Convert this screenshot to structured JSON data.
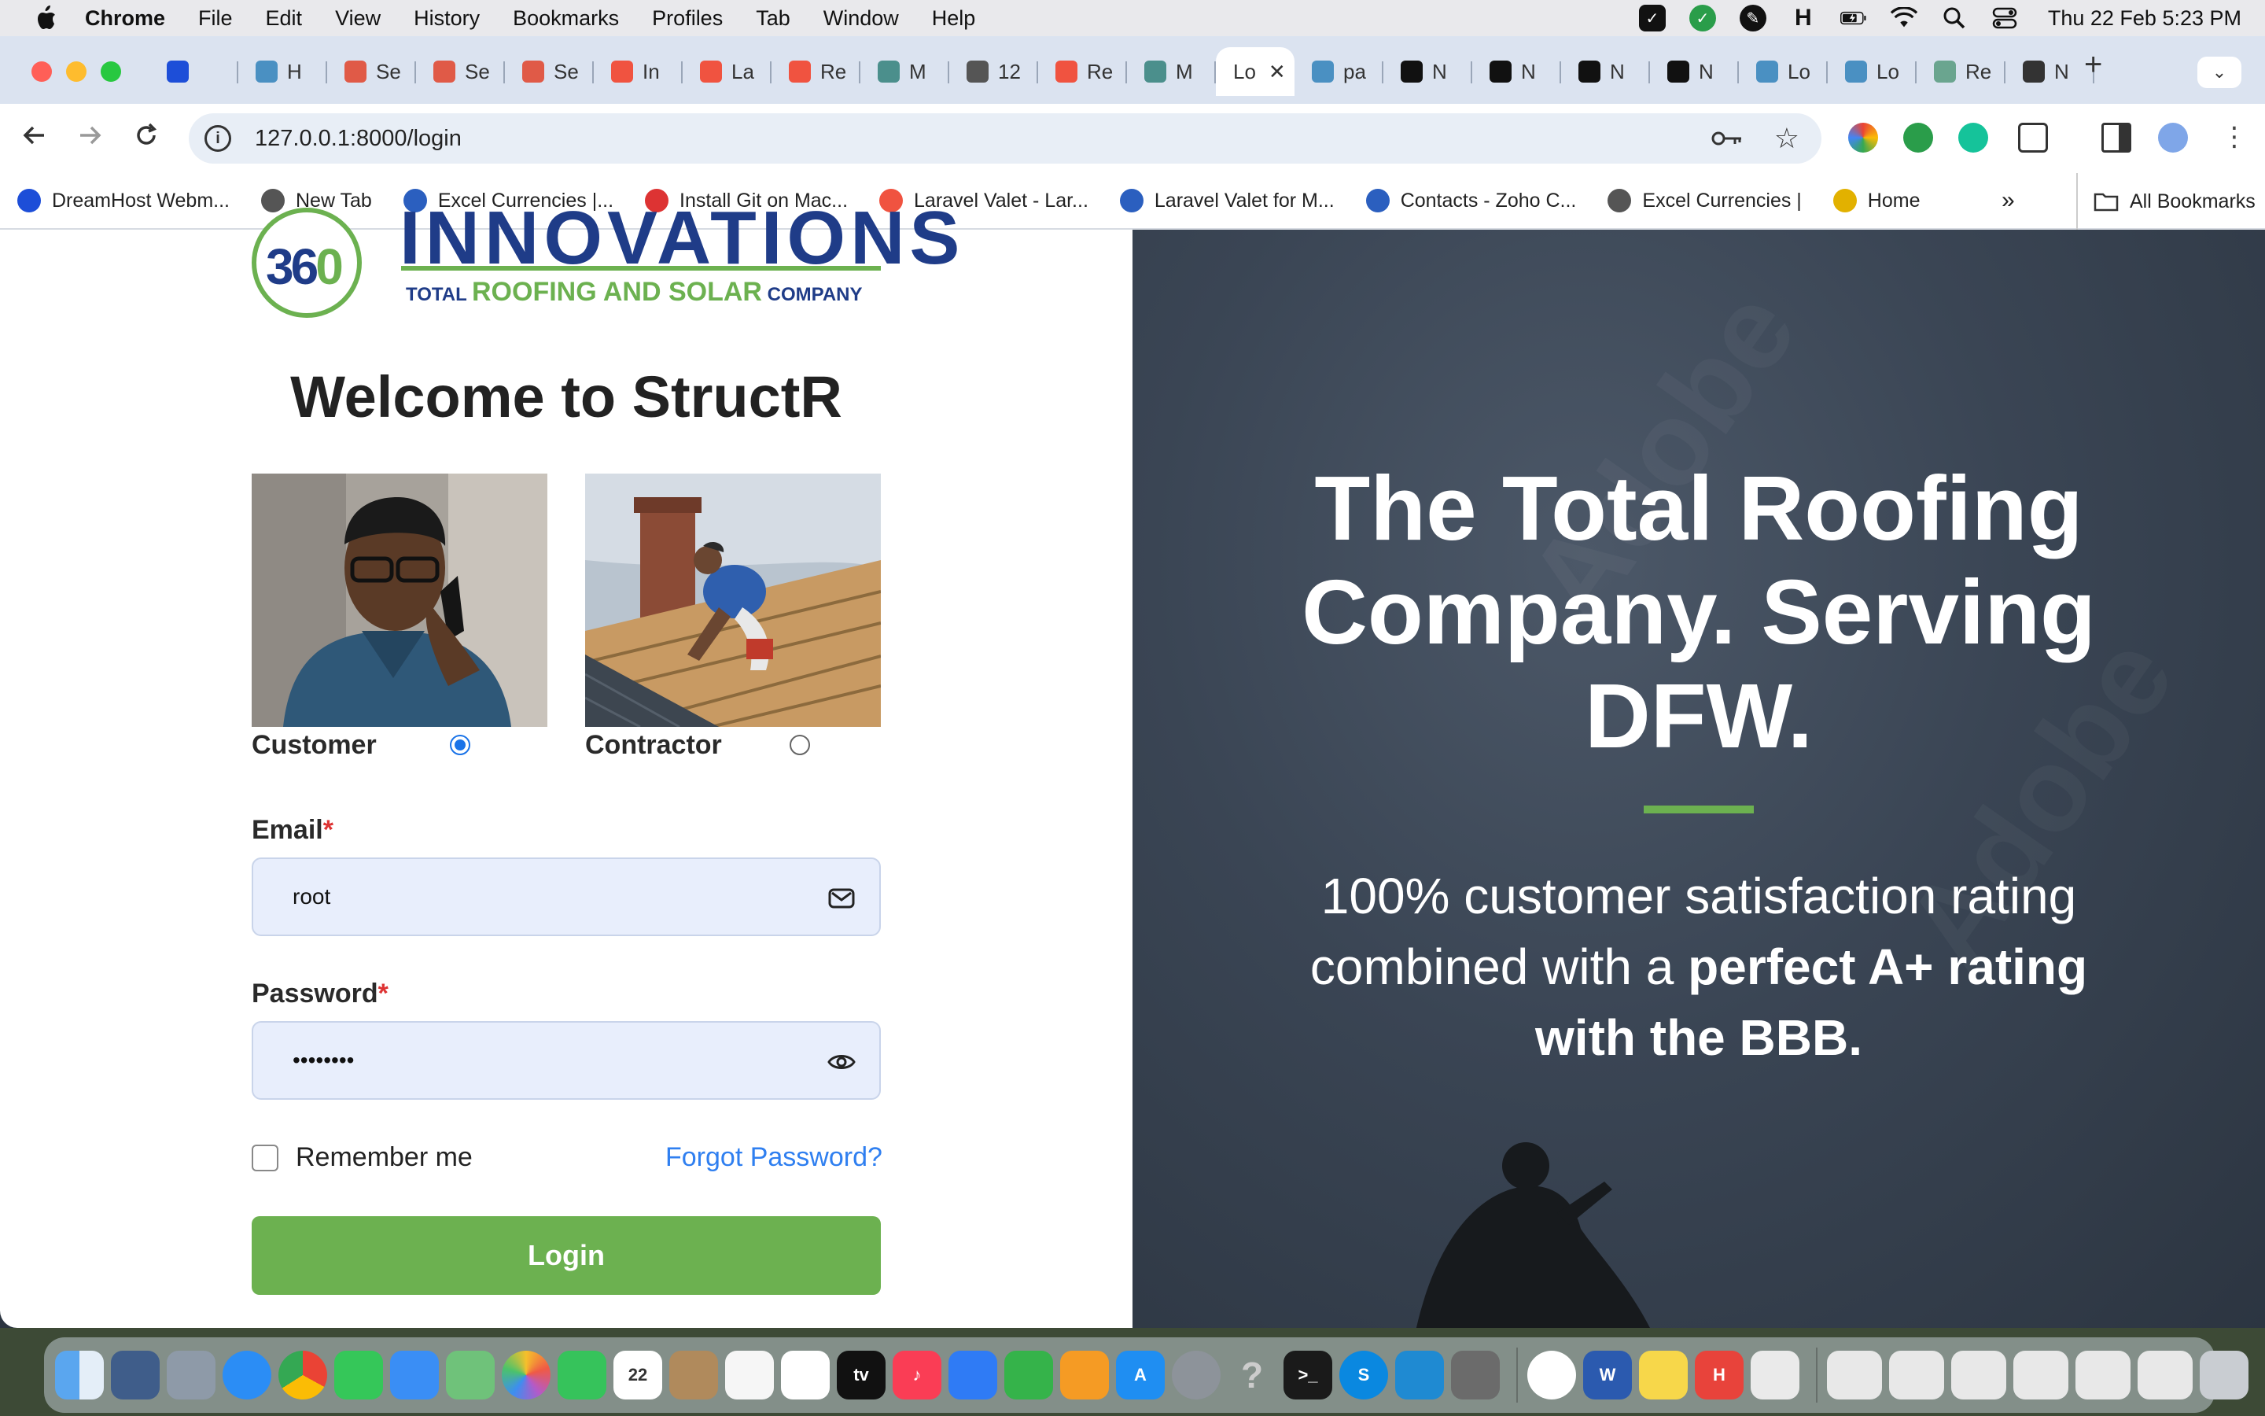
{
  "menubar": {
    "app": "Chrome",
    "items": [
      "File",
      "Edit",
      "View",
      "History",
      "Bookmarks",
      "Profiles",
      "Tab",
      "Window",
      "Help"
    ],
    "datetime": "Thu 22 Feb  5:23 PM"
  },
  "tabs": [
    {
      "label": "",
      "icon": "blue-sphere-icon",
      "color": "#1d4ed8"
    },
    {
      "label": "H",
      "icon": "site-icon",
      "color": "#4a90c2"
    },
    {
      "label": "Se",
      "icon": "site-icon",
      "color": "#e05a47"
    },
    {
      "label": "Se",
      "icon": "site-icon",
      "color": "#e05a47"
    },
    {
      "label": "Se",
      "icon": "site-icon",
      "color": "#e05a47"
    },
    {
      "label": "In",
      "icon": "laravel-icon",
      "color": "#f05340"
    },
    {
      "label": "La",
      "icon": "laravel-icon",
      "color": "#f05340"
    },
    {
      "label": "Re",
      "icon": "laravel-icon",
      "color": "#f05340"
    },
    {
      "label": "M",
      "icon": "m-icon",
      "color": "#4b8f8c"
    },
    {
      "label": "12",
      "icon": "globe-icon",
      "color": "#555"
    },
    {
      "label": "Re",
      "icon": "laravel-icon",
      "color": "#f05340"
    },
    {
      "label": "M",
      "icon": "m-icon",
      "color": "#4b8f8c"
    },
    {
      "label": "Lo",
      "icon": "",
      "color": "#ffffff",
      "active": true
    },
    {
      "label": "pa",
      "icon": "site-icon",
      "color": "#4a90c2"
    },
    {
      "label": "N",
      "icon": "a-icon",
      "color": "#111"
    },
    {
      "label": "N",
      "icon": "a-icon",
      "color": "#111"
    },
    {
      "label": "N",
      "icon": "a-icon",
      "color": "#111"
    },
    {
      "label": "N",
      "icon": "a-icon",
      "color": "#111"
    },
    {
      "label": "Lo",
      "icon": "site-icon",
      "color": "#4a90c2"
    },
    {
      "label": "Lo",
      "icon": "site-icon",
      "color": "#4a90c2"
    },
    {
      "label": "Re",
      "icon": "openai-icon",
      "color": "#6aa58f"
    },
    {
      "label": "N",
      "icon": "github-icon",
      "color": "#333"
    }
  ],
  "address": {
    "url": "127.0.0.1:8000/login"
  },
  "bookmarks": [
    {
      "label": "DreamHost Webm...",
      "color": "#1d4ed8"
    },
    {
      "label": "New Tab",
      "color": "#555"
    },
    {
      "label": "Excel Currencies |...",
      "color": "#2b5fbf"
    },
    {
      "label": "Install Git on Mac...",
      "color": "#d33"
    },
    {
      "label": "Laravel Valet - Lar...",
      "color": "#f05340"
    },
    {
      "label": "Laravel Valet for M...",
      "color": "#2b5fbf"
    },
    {
      "label": "Contacts - Zoho C...",
      "color": "#2b5fbf"
    },
    {
      "label": "Excel Currencies |",
      "color": "#555"
    },
    {
      "label": "Home",
      "color": "#e2b100"
    }
  ],
  "bookmarks_all": "All Bookmarks",
  "logo": {
    "digits_a": "36",
    "digits_b": "0",
    "name": "INNOVATIONS",
    "tag_pre": "TOTAL ",
    "tag_main": "ROOFING AND SOLAR",
    "tag_post": " COMPANY"
  },
  "login": {
    "welcome": "Welcome to StructR",
    "role_customer": "Customer",
    "role_contractor": "Contractor",
    "selected_role": "Customer",
    "email_label": "Email",
    "email_value": "root",
    "password_label": "Password",
    "password_value": "••••••••",
    "required_mark": "*",
    "remember_label": "Remember me",
    "forgot_label": "Forgot Password?",
    "login_label": "Login"
  },
  "hero": {
    "title": "The Total Roofing Company. Serving DFW.",
    "sub_plain": "100% customer satisfaction rating combined with a ",
    "sub_bold": "perfect A+ rating with the BBB."
  },
  "colors": {
    "brand_green": "#6cb150",
    "link_blue": "#2f7ff0",
    "input_bg": "#e8eefc"
  }
}
